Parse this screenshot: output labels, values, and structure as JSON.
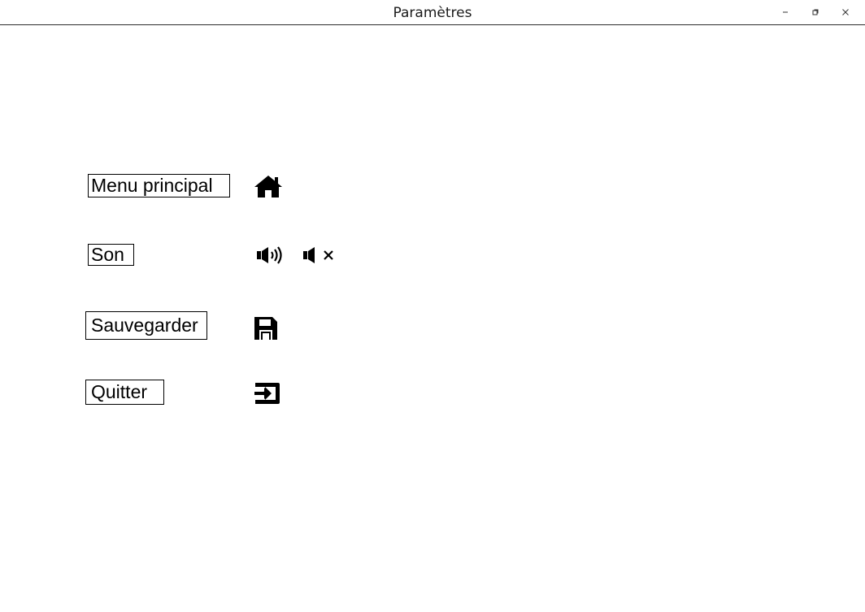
{
  "window": {
    "title": "Paramètres",
    "controls": [
      "minimize-icon",
      "restore-icon",
      "close-icon"
    ]
  },
  "menu": {
    "items": [
      {
        "label": "Menu principal",
        "icon": "home-icon"
      },
      {
        "label": "Son",
        "icons": [
          "sound-on-icon",
          "sound-off-icon"
        ]
      },
      {
        "label": "Sauvegarder",
        "icon": "save-icon"
      },
      {
        "label": "Quitter",
        "icon": "exit-icon"
      }
    ]
  },
  "colors": {
    "background": "#ffffff",
    "foreground": "#000000"
  }
}
